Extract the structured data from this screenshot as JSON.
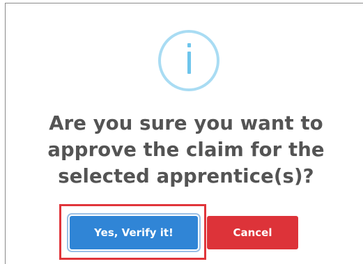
{
  "icon": {
    "name": "info-icon",
    "color": "#6ec5ec",
    "ring_color": "#a9dcf3"
  },
  "dialog": {
    "title": "Are you sure you want to approve the claim for the selected apprentice(s)?"
  },
  "buttons": {
    "confirm_label": "Yes, Verify it!",
    "cancel_label": "Cancel"
  },
  "colors": {
    "confirm": "#3085d6",
    "cancel": "#dd3339",
    "highlight": "#e0353a",
    "title_text": "#545454"
  }
}
